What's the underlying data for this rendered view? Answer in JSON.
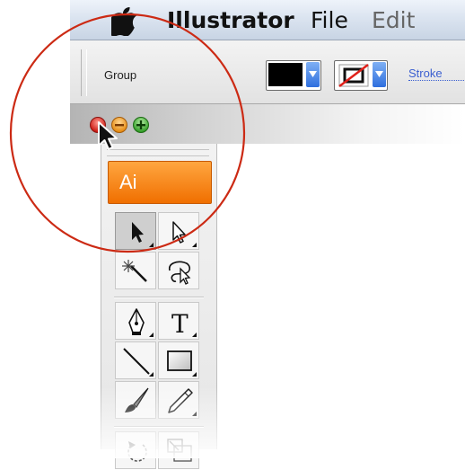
{
  "menubar": {
    "apple_icon": "apple-logo-icon",
    "items": [
      {
        "label": "Illustrator"
      },
      {
        "label": "File"
      },
      {
        "label": "Edit"
      }
    ]
  },
  "controlbar": {
    "selection_label": "Group",
    "fill_color": "#000000",
    "stroke_color": "none",
    "stroke_link": "Stroke"
  },
  "window_buttons": [
    {
      "name": "close",
      "color": "#e2352c"
    },
    {
      "name": "minimize",
      "color": "#f4a023"
    },
    {
      "name": "zoom",
      "color": "#37b233"
    }
  ],
  "tools_panel": {
    "badge": "Ai",
    "badge_color": "#f57a00",
    "tools": [
      {
        "name": "selection-tool",
        "icon": "black-arrow-icon",
        "selected": true
      },
      {
        "name": "direct-selection-tool",
        "icon": "white-arrow-icon",
        "selected": false
      },
      {
        "name": "magic-wand-tool",
        "icon": "magic-wand-icon",
        "selected": false
      },
      {
        "name": "lasso-tool",
        "icon": "lasso-icon",
        "selected": false
      },
      {
        "name": "pen-tool",
        "icon": "pen-nib-icon",
        "selected": false
      },
      {
        "name": "type-tool",
        "icon": "type-icon",
        "label": "T",
        "selected": false
      },
      {
        "name": "line-tool",
        "icon": "line-segment-icon",
        "selected": false
      },
      {
        "name": "rectangle-tool",
        "icon": "rectangle-icon",
        "selected": false
      },
      {
        "name": "paintbrush-tool",
        "icon": "paintbrush-icon",
        "selected": false
      },
      {
        "name": "pencil-tool",
        "icon": "pencil-icon",
        "selected": false
      },
      {
        "name": "rotate-tool",
        "icon": "rotate-icon",
        "selected": false
      },
      {
        "name": "scale-tool",
        "icon": "scale-icon",
        "selected": false
      }
    ]
  },
  "annotation": {
    "color": "#cc2a14"
  }
}
